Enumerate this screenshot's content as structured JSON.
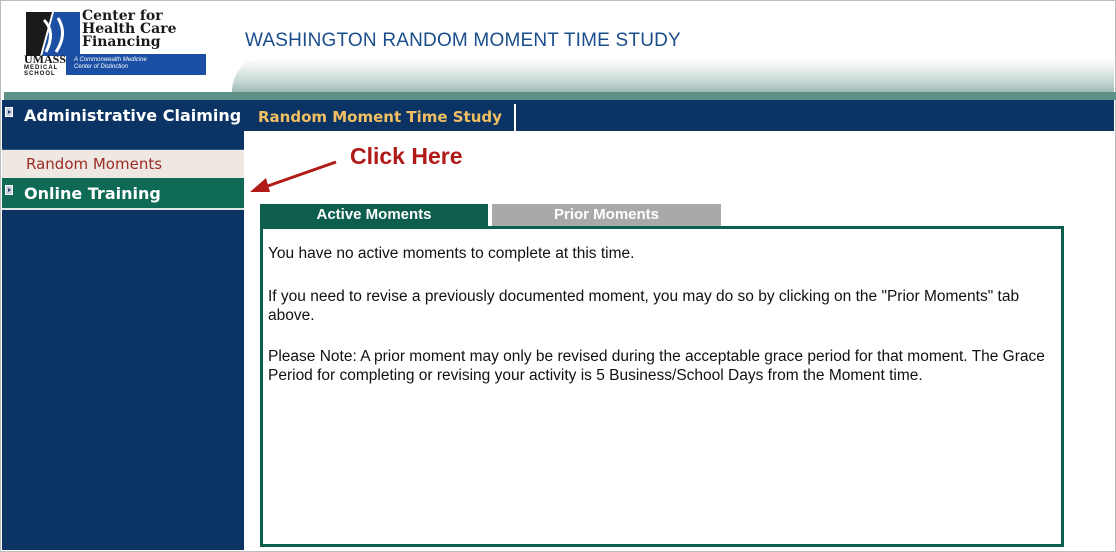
{
  "header": {
    "logo": {
      "name_line1": "Center for",
      "name_line2": "Health Care",
      "name_line3": "Financing",
      "umass": "UMASS.",
      "umass_sub1": "MEDICAL",
      "umass_sub2": "SCHOOL",
      "tagline1": "A Commonwealth Medicine",
      "tagline2": "Center of Distinction"
    },
    "app_title": "WASHINGTON RANDOM MOMENT TIME STUDY"
  },
  "sidebar": {
    "items": [
      {
        "label": "Administrative Claiming"
      },
      {
        "label": "Random Moments"
      },
      {
        "label": "Online Training"
      }
    ]
  },
  "main": {
    "section_title": "Random Moment Time Study",
    "annotation": "Click Here",
    "tabs": [
      {
        "label": "Active Moments",
        "active": true
      },
      {
        "label": "Prior Moments",
        "active": false
      }
    ],
    "messages": [
      "You have no active moments to complete at this time.",
      "If you need to revise a previously documented moment, you may do so by clicking on the \"Prior Moments\" tab above.",
      "Please Note: A prior moment may only be revised during the acceptable grace period for that moment. The Grace Period for completing or revising your activity is 5 Business/School Days from the Moment time."
    ]
  },
  "colors": {
    "navy": "#0b3363",
    "teal": "#0d5e4c",
    "annotation_red": "#b01a17",
    "section_title_gold": "#f2c062"
  },
  "icons": {
    "logo": "umass-logo-icon",
    "bullet": "arrow-bullet-icon",
    "pointer": "red-arrow-icon"
  }
}
